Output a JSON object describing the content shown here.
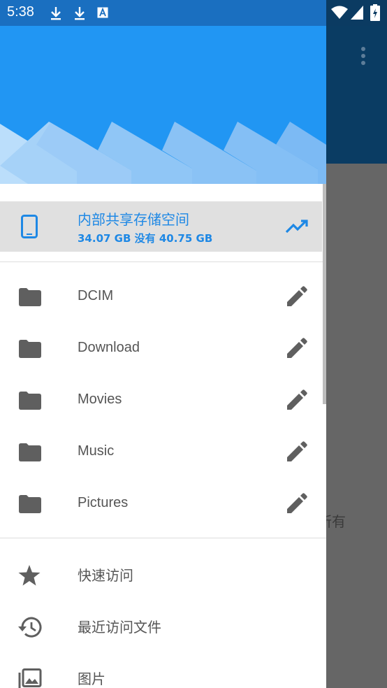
{
  "status_bar": {
    "time": "5:38",
    "icons": [
      "download-icon",
      "download-icon",
      "font-notification-icon",
      "wifi-icon",
      "signal-icon",
      "battery-icon"
    ]
  },
  "drawer": {
    "storage": {
      "title": "内部共享存储空间",
      "usage": "34.07 GB 没有 40.75 GB",
      "icon": "phone-icon",
      "trend_icon": "trending-up-icon"
    },
    "folders": [
      {
        "label": "DCIM"
      },
      {
        "label": "Download"
      },
      {
        "label": "Movies"
      },
      {
        "label": "Music"
      },
      {
        "label": "Pictures"
      }
    ],
    "nav": [
      {
        "label": "快速访问",
        "icon": "star-icon"
      },
      {
        "label": "最近访问文件",
        "icon": "history-icon"
      },
      {
        "label": "图片",
        "icon": "image-icon"
      }
    ]
  },
  "background": {
    "partial_text": "所有"
  },
  "colors": {
    "accent": "#2196f3",
    "header_blue": "#2196f3",
    "status_bar": "#1a6fc0",
    "toolbar_dark": "#0a3c63",
    "selected_row": "#e0e0e0",
    "icon_gray": "#555555"
  }
}
